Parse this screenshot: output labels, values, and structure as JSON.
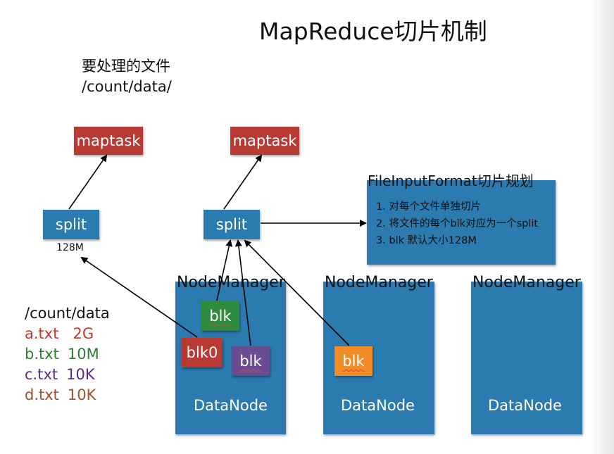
{
  "title": "MapReduce切片机制",
  "note": {
    "line1": "要处理的文件",
    "line2": "/count/data/"
  },
  "maptasks": [
    "maptask",
    "maptask"
  ],
  "splits": [
    {
      "label": "split",
      "size": "128M"
    },
    {
      "label": "split"
    }
  ],
  "input_format": {
    "title": "FileInputFormat切片规划",
    "items": [
      "1. 对每个文件单独切片",
      "2. 将文件的每个blk对应为一个split",
      "3. blk 默认大小128M"
    ]
  },
  "nodes": [
    {
      "manager": "NodeManager",
      "datanode": "DataNode"
    },
    {
      "manager": "NodeManager",
      "datanode": "DataNode"
    },
    {
      "manager": "NodeManager",
      "datanode": "DataNode"
    }
  ],
  "blocks": [
    "blk",
    "blk0",
    "blk",
    "blk"
  ],
  "files": {
    "header": "/count/data",
    "items": [
      {
        "name": "a.txt",
        "size": "2G",
        "color": "#c0392b"
      },
      {
        "name": "b.txt",
        "size": "10M",
        "color": "#2e7d32"
      },
      {
        "name": "c.txt",
        "size": "10K",
        "color": "#5b2c83"
      },
      {
        "name": "d.txt",
        "size": "10K",
        "color": "#a0522d"
      }
    ]
  },
  "colors": {
    "maptask": "#b83a34",
    "node": "#2b7bb0",
    "blk_green": "#2e8b3e",
    "blk0_red": "#b83a34",
    "blk_purple": "#6a4c93",
    "blk_orange": "#f28c28"
  }
}
